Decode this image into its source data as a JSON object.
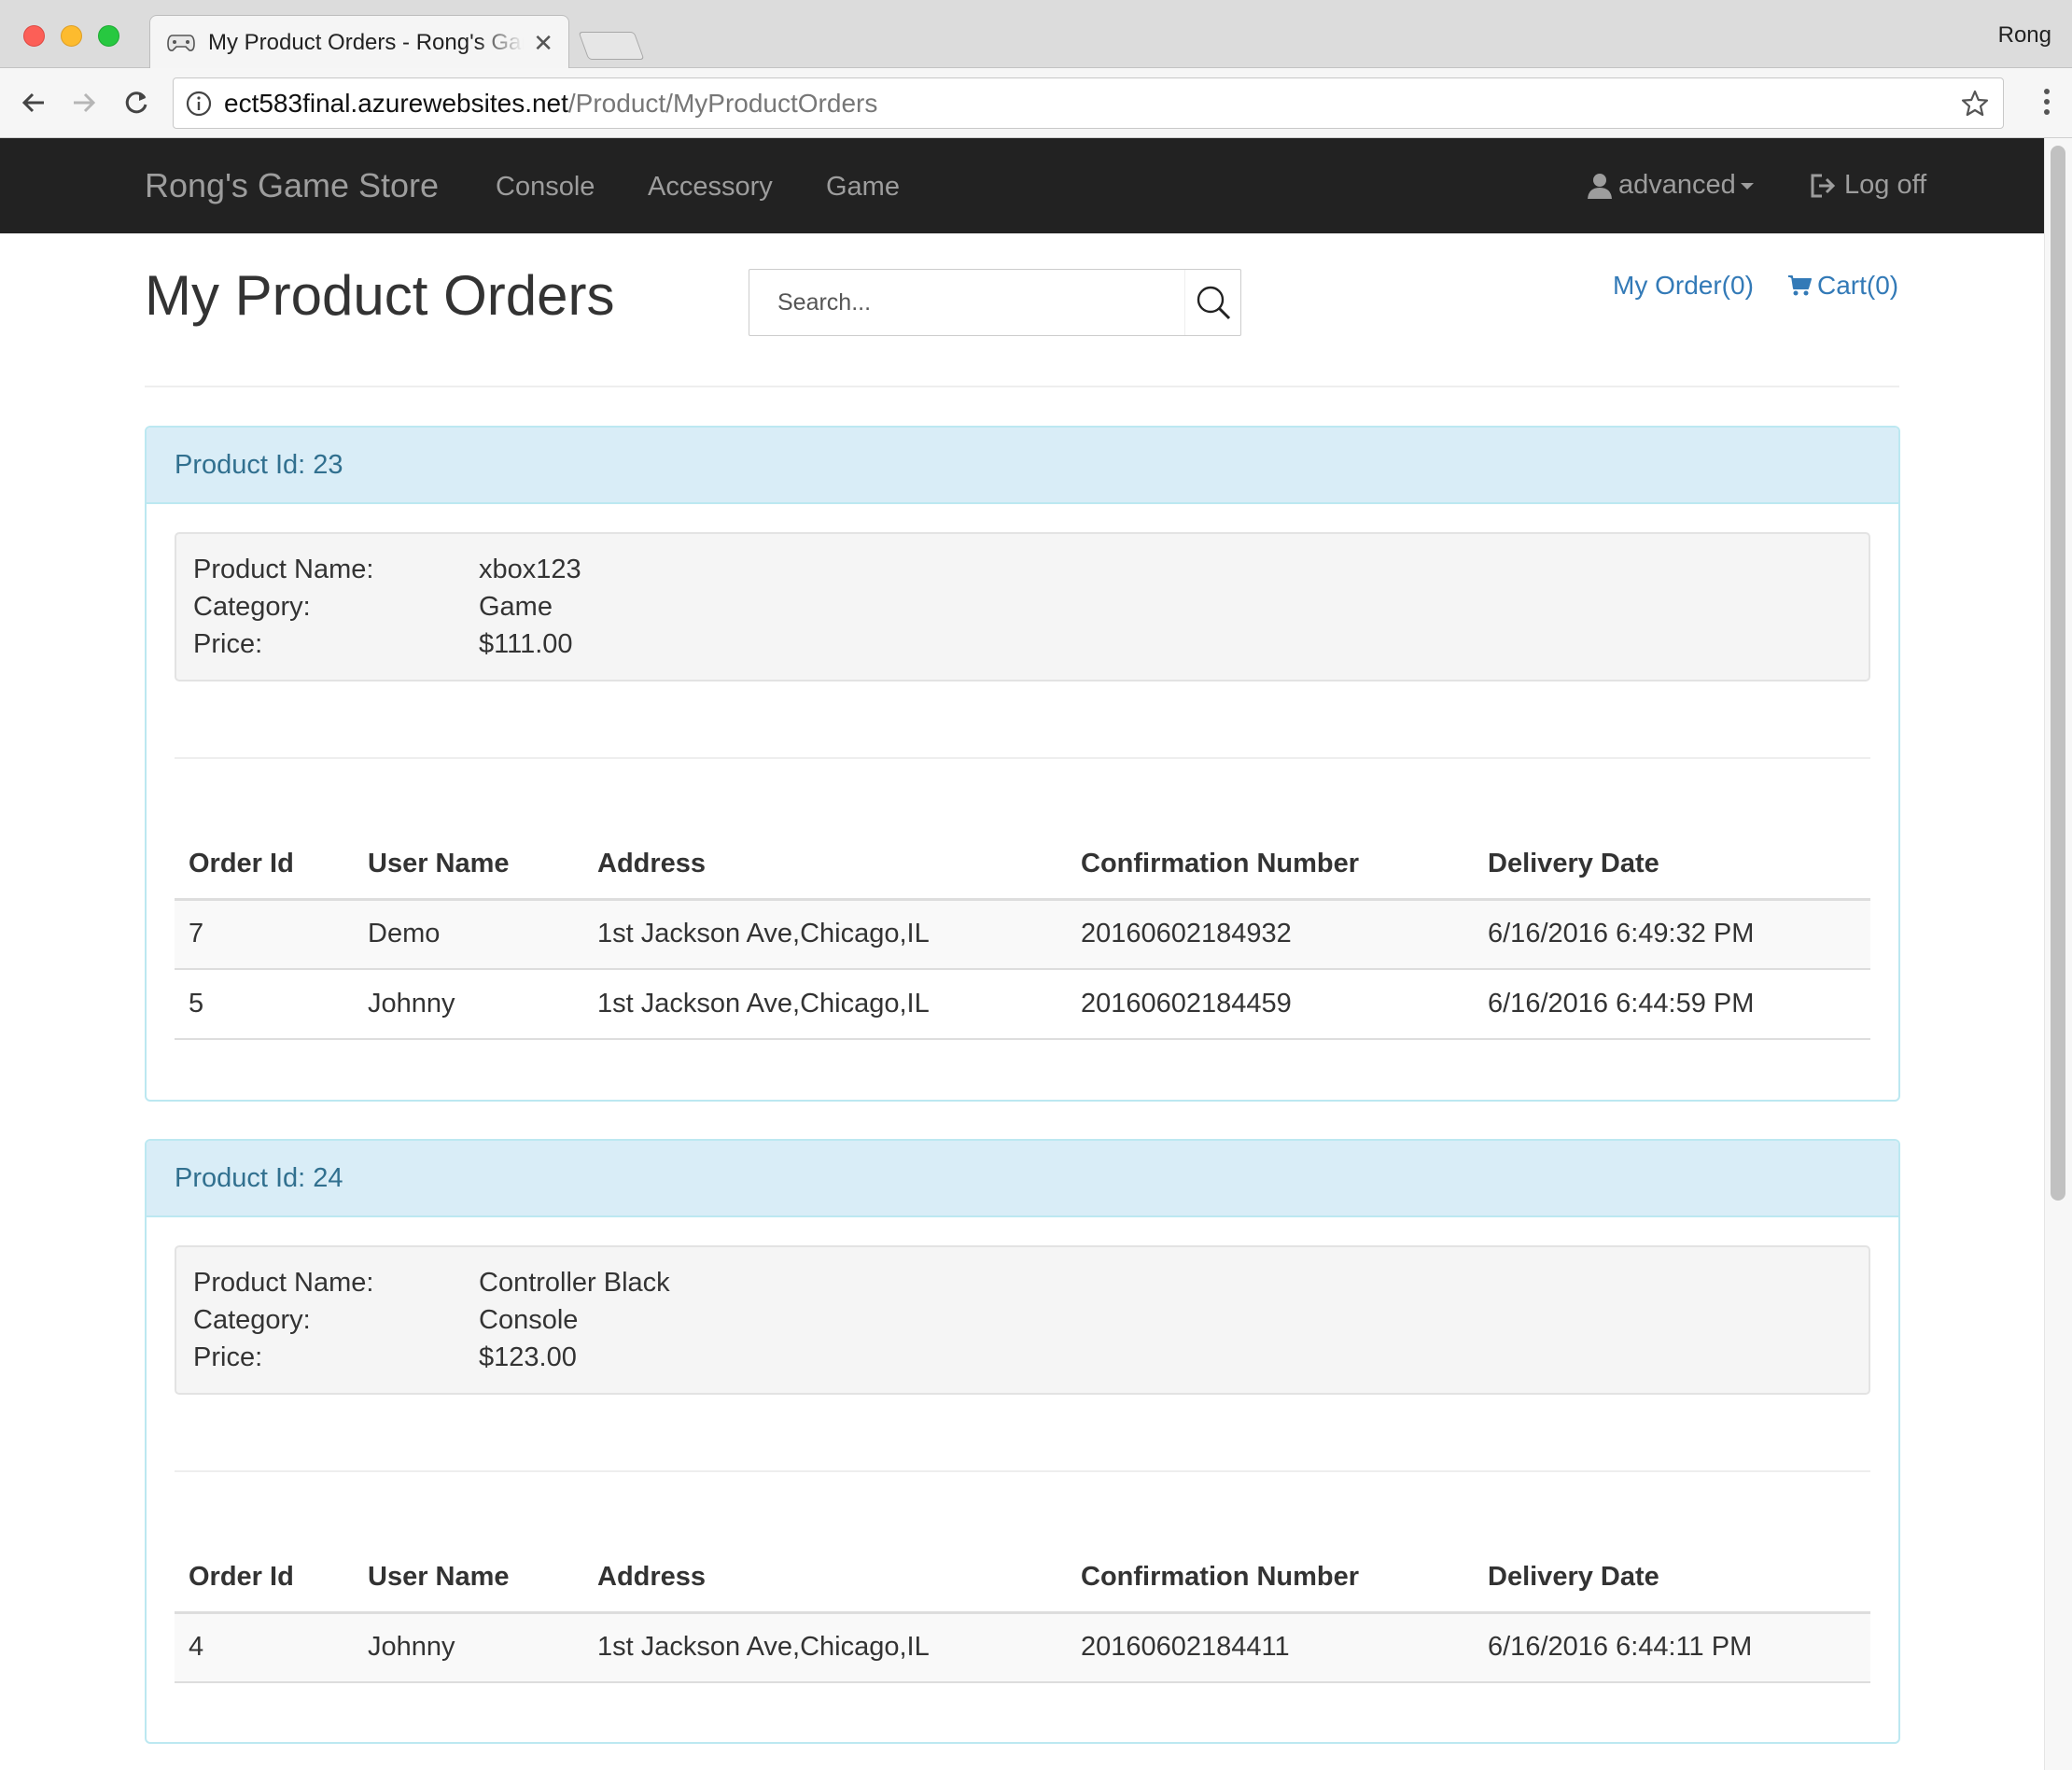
{
  "browser": {
    "tab_title": "My Product Orders - Rong's Game Store",
    "profile_name": "Rong",
    "url_host": "ect583final.azurewebsites.net",
    "url_path": "/Product/MyProductOrders"
  },
  "navbar": {
    "brand": "Rong's Game Store",
    "links": [
      "Console",
      "Accessory",
      "Game"
    ],
    "user": "advanced",
    "logoff": "Log off"
  },
  "page": {
    "title": "My Product Orders",
    "search_placeholder": "Search...",
    "my_order_link": "My Order(0)",
    "cart_link": "Cart(0)"
  },
  "labels": {
    "product_id_prefix": "Product Id: ",
    "product_name": "Product Name:",
    "category": "Category:",
    "price": "Price:"
  },
  "table_headers": [
    "Order Id",
    "User Name",
    "Address",
    "Confirmation Number",
    "Delivery Date"
  ],
  "products": [
    {
      "heading": "Product Id: 23",
      "name": "xbox123",
      "category": "Game",
      "price": "$111.00",
      "orders": [
        [
          "7",
          "Demo",
          "1st Jackson Ave,Chicago,IL",
          "20160602184932",
          "6/16/2016 6:49:32 PM"
        ],
        [
          "5",
          "Johnny",
          "1st Jackson Ave,Chicago,IL",
          "20160602184459",
          "6/16/2016 6:44:59 PM"
        ]
      ]
    },
    {
      "heading": "Product Id: 24",
      "name": "Controller Black",
      "category": "Console",
      "price": "$123.00",
      "orders": [
        [
          "4",
          "Johnny",
          "1st Jackson Ave,Chicago,IL",
          "20160602184411",
          "6/16/2016 6:44:11 PM"
        ]
      ]
    }
  ],
  "colors": {
    "navbar_bg": "#222222",
    "navbar_text": "#9d9d9d",
    "link": "#337ab7",
    "panel_heading_bg": "#d9edf7",
    "panel_border": "#bce8f1",
    "panel_heading_text": "#31708f"
  }
}
